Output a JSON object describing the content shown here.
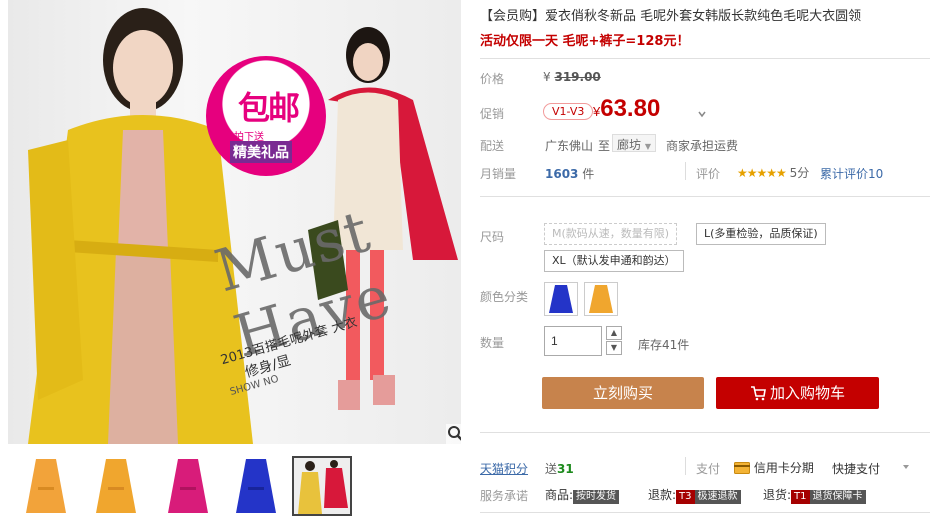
{
  "gallery": {
    "badge_big": "包邮",
    "badge_small": "拍下送",
    "badge_gift": "精美礼品",
    "watermark": "Must Have",
    "slogan": "2013百搭毛呢外套 大衣",
    "slogan2": "修身/显",
    "slogan3": "SHOW NO",
    "thumb_colors": [
      "#f2a33a",
      "#f0a62e",
      "#d81c7a",
      "#2434c8",
      "#e8c23c"
    ]
  },
  "product": {
    "title": "【会员购】爱衣俏秋冬新品 毛呢外套女韩版长款纯色毛呢大衣圆领",
    "promo_line": "活动仅限一天 毛呢+裤子=128元！"
  },
  "price": {
    "orig_label": "价格",
    "orig_currency": "¥",
    "orig_value": "319.00",
    "promo_label": "促销",
    "member_badge": "V1-V3",
    "promo_currency": "¥",
    "promo_value": "63.80"
  },
  "shipping": {
    "label": "配送",
    "from": "广东佛山",
    "to_word": "至",
    "to_city": "廊坊",
    "fee_note": "商家承担运费"
  },
  "sales": {
    "label": "月销量",
    "count": "1603",
    "unit": "件",
    "rating_label": "评价",
    "stars": "★★★★★",
    "score": "5分",
    "review_text": "累计评价10"
  },
  "options": {
    "size_label": "尺码",
    "sizes": [
      "M(款码从速，数量有限)",
      "L(多重检验，品质保证)",
      "XL（默认发申通和韵达）"
    ],
    "color_label": "颜色分类",
    "swatch_colors": [
      "#2434c8",
      "#f0a62e"
    ],
    "qty_label": "数量",
    "qty_value": "1",
    "stock": "库存41件"
  },
  "actions": {
    "buy_label": "立刻购买",
    "cart_label": "加入购物车"
  },
  "footer": {
    "points_label": "天猫积分",
    "points_prefix": "送",
    "points_value": "31",
    "pay_label": "支付",
    "pay_credit": "信用卡分期",
    "pay_quick": "快捷支付",
    "service_label": "服务承诺",
    "svc_goods": "商品:",
    "svc_goods_tag": "按时发货",
    "svc_refund": "退款:",
    "svc_refund_code": "T3",
    "svc_refund_tag": "极速退款",
    "svc_return": "退货:",
    "svc_return_code": "T1",
    "svc_return_tag": "退货保障卡"
  },
  "colors": {
    "accent_red": "#c40000",
    "buy_brown": "#c7834c",
    "points_green": "#1d8a1d"
  }
}
